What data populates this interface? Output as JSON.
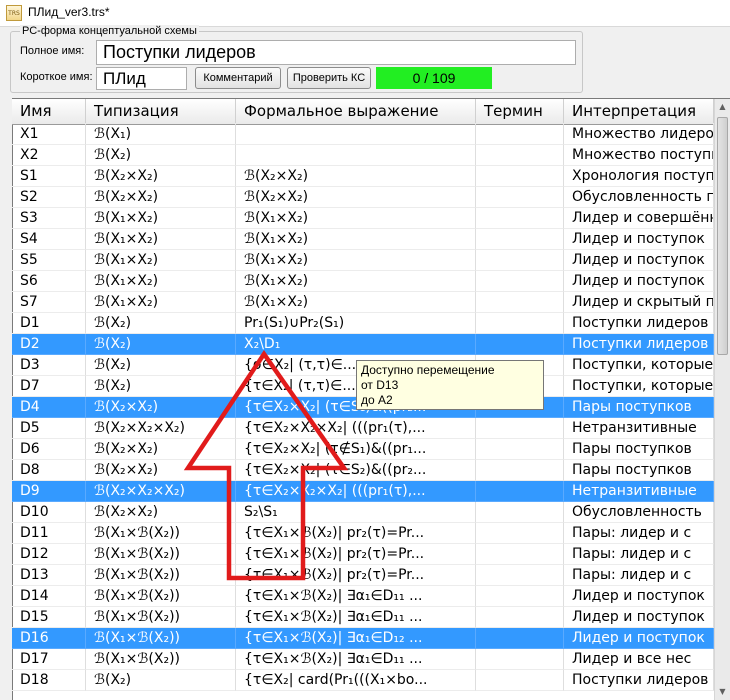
{
  "window": {
    "title": "ПЛид_ver3.trs*",
    "icon": "trs-file-icon",
    "icon_text": "TRS"
  },
  "form": {
    "group_caption": "РС-форма концептуальной схемы",
    "full_name_label": "Полное имя:",
    "full_name_value": "Поступки лидеров",
    "short_name_label": "Короткое имя:",
    "short_name_value": "ПЛид",
    "comment_button": "Комментарий",
    "check_button": "Проверить КС",
    "status_text": "0 / 109",
    "status_color": "#22ee22"
  },
  "table": {
    "columns": [
      "Имя",
      "Типизация",
      "Формальное выражение",
      "Термин",
      "Интерпретация"
    ],
    "rows": [
      {
        "name": "X1",
        "type": "ℬ(X₁)",
        "expr": "",
        "term": "",
        "interp": "Множество лидеров"
      },
      {
        "name": "X2",
        "type": "ℬ(X₂)",
        "expr": "",
        "term": "",
        "interp": "Множество поступков"
      },
      {
        "name": "S1",
        "type": "ℬ(X₂×X₂)",
        "expr": "ℬ(X₂×X₂)",
        "term": "",
        "interp": "Хронология поступков"
      },
      {
        "name": "S2",
        "type": "ℬ(X₂×X₂)",
        "expr": "ℬ(X₂×X₂)",
        "term": "",
        "interp": "Обусловленность поступков"
      },
      {
        "name": "S3",
        "type": "ℬ(X₁×X₂)",
        "expr": "ℬ(X₁×X₂)",
        "term": "",
        "interp": "Лидер и совершённый поступок"
      },
      {
        "name": "S4",
        "type": "ℬ(X₁×X₂)",
        "expr": "ℬ(X₁×X₂)",
        "term": "",
        "interp": "Лидер и поступок"
      },
      {
        "name": "S5",
        "type": "ℬ(X₁×X₂)",
        "expr": "ℬ(X₁×X₂)",
        "term": "",
        "interp": "Лидер и поступок"
      },
      {
        "name": "S6",
        "type": "ℬ(X₁×X₂)",
        "expr": "ℬ(X₁×X₂)",
        "term": "",
        "interp": "Лидер и поступок"
      },
      {
        "name": "S7",
        "type": "ℬ(X₁×X₂)",
        "expr": "ℬ(X₁×X₂)",
        "term": "",
        "interp": "Лидер и скрытый поступок"
      },
      {
        "name": "D1",
        "type": "ℬ(X₂)",
        "expr": "Pr₁(S₁)∪Pr₂(S₁)",
        "term": "",
        "interp": "Поступки лидеров"
      },
      {
        "name": "D2",
        "type": "ℬ(X₂)",
        "expr": "X₂\\D₁",
        "term": "",
        "interp": "Поступки лидеров",
        "selected": true
      },
      {
        "name": "D3",
        "type": "ℬ(X₂)",
        "expr": "{σ∈X₂| (τ,τ)∈...",
        "term": "",
        "interp": "Поступки, которые"
      },
      {
        "name": "D7",
        "type": "ℬ(X₂)",
        "expr": "{τ∈X₂| (τ,τ)∈...",
        "term": "",
        "interp": "Поступки, которые"
      },
      {
        "name": "D4",
        "type": "ℬ(X₂×X₂)",
        "expr": "{τ∈X₂×X₂| (τ∈S₁)&((pr₂...",
        "term": "",
        "interp": "Пары поступков",
        "selected": true
      },
      {
        "name": "D5",
        "type": "ℬ(X₂×X₂×X₂)",
        "expr": "{τ∈X₂×X₂×X₂| (((pr₁(τ),...",
        "term": "",
        "interp": "Нетранзитивные"
      },
      {
        "name": "D6",
        "type": "ℬ(X₂×X₂)",
        "expr": "{τ∈X₂×X₂| (τ∉S₁)&((pr₁...",
        "term": "",
        "interp": "Пары поступков"
      },
      {
        "name": "D8",
        "type": "ℬ(X₂×X₂)",
        "expr": "{τ∈X₂×X₂| (τ∈S₂)&((pr₂...",
        "term": "",
        "interp": "Пары поступков"
      },
      {
        "name": "D9",
        "type": "ℬ(X₂×X₂×X₂)",
        "expr": "{τ∈X₂×X₂×X₂| (((pr₁(τ),...",
        "term": "",
        "interp": "Нетранзитивные",
        "selected": true
      },
      {
        "name": "D10",
        "type": "ℬ(X₂×X₂)",
        "expr": "S₂\\S₁",
        "term": "",
        "interp": "Обусловленность"
      },
      {
        "name": "D11",
        "type": "ℬ(X₁×ℬ(X₂))",
        "expr": "{τ∈X₁×ℬ(X₂)| pr₂(τ)=Pr...",
        "term": "",
        "interp": "Пары: лидер и с"
      },
      {
        "name": "D12",
        "type": "ℬ(X₁×ℬ(X₂))",
        "expr": "{τ∈X₁×ℬ(X₂)| pr₂(τ)=Pr...",
        "term": "",
        "interp": "Пары: лидер и с"
      },
      {
        "name": "D13",
        "type": "ℬ(X₁×ℬ(X₂))",
        "expr": "{τ∈X₁×ℬ(X₂)| pr₂(τ)=Pr...",
        "term": "",
        "interp": "Пары: лидер и с"
      },
      {
        "name": "D14",
        "type": "ℬ(X₁×ℬ(X₂))",
        "expr": "{τ∈X₁×ℬ(X₂)| ∃α₁∈D₁₁ ...",
        "term": "",
        "interp": "Лидер и поступок"
      },
      {
        "name": "D15",
        "type": "ℬ(X₁×ℬ(X₂))",
        "expr": "{τ∈X₁×ℬ(X₂)| ∃α₁∈D₁₁ ...",
        "term": "",
        "interp": "Лидер и поступок"
      },
      {
        "name": "D16",
        "type": "ℬ(X₁×ℬ(X₂))",
        "expr": "{τ∈X₁×ℬ(X₂)| ∃α₁∈D₁₂ ...",
        "term": "",
        "interp": "Лидер и поступок",
        "selected": true
      },
      {
        "name": "D17",
        "type": "ℬ(X₁×ℬ(X₂))",
        "expr": "{τ∈X₁×ℬ(X₂)| ∃α₁∈D₁₁ ...",
        "term": "",
        "interp": "Лидер и все нес"
      },
      {
        "name": "D18",
        "type": "ℬ(X₂)",
        "expr": "{τ∈X₂| card(Pr₁(((X₁×bo...",
        "term": "",
        "interp": "Поступки лидеров"
      }
    ]
  },
  "tooltip": {
    "line1": "Доступно перемещение",
    "line2": "от D13",
    "line3": "до A2"
  },
  "annotation": {
    "shape": "red-up-arrow-outline",
    "color": "#e11b1b"
  }
}
